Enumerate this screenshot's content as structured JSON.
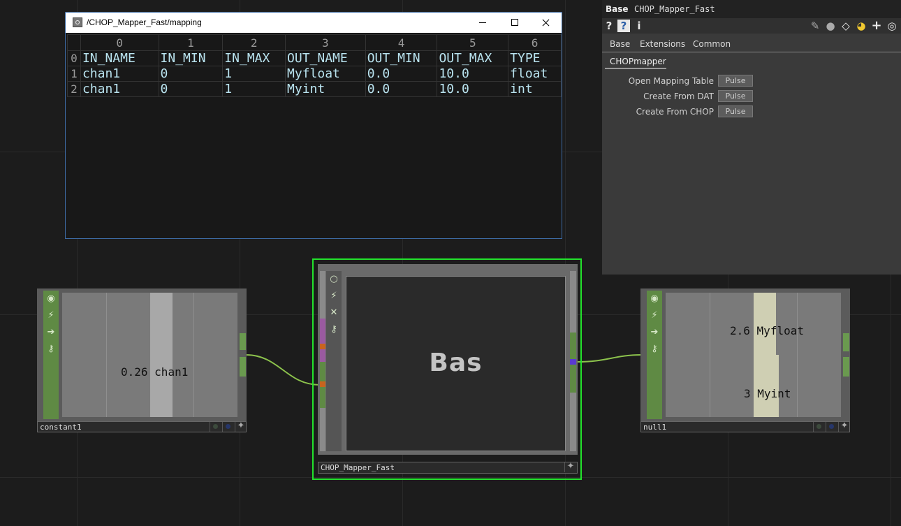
{
  "viewer_window": {
    "title": "/CHOP_Mapper_Fast/mapping",
    "col_headers": [
      "0",
      "1",
      "2",
      "3",
      "4",
      "5",
      "6"
    ],
    "rows": [
      {
        "index": "0",
        "cells": [
          "IN_NAME",
          "IN_MIN",
          "IN_MAX",
          "OUT_NAME",
          "OUT_MIN",
          "OUT_MAX",
          "TYPE"
        ]
      },
      {
        "index": "1",
        "cells": [
          "chan1",
          "0",
          "1",
          "Myfloat",
          "0.0",
          "10.0",
          "float"
        ]
      },
      {
        "index": "2",
        "cells": [
          "chan1",
          "0",
          "1",
          "Myint",
          "0.0",
          "10.0",
          "int"
        ]
      }
    ]
  },
  "param_panel": {
    "op_type": "Base",
    "op_name": "CHOP_Mapper_Fast",
    "icons": [
      "help-icon",
      "python-help-icon",
      "info-icon",
      "pencil-icon",
      "comment-icon",
      "clone-icon",
      "python-icon",
      "plus-icon",
      "target-icon"
    ],
    "tabs": [
      "Base",
      "Extensions",
      "Common"
    ],
    "active_page": "CHOPmapper",
    "params": [
      {
        "label": "Open Mapping Table",
        "button": "Pulse"
      },
      {
        "label": "Create From DAT",
        "button": "Pulse"
      },
      {
        "label": "Create From CHOP",
        "button": "Pulse"
      }
    ]
  },
  "nodes": {
    "constant1": {
      "name": "constant1",
      "value": "0.26",
      "channel": "chan1",
      "value_fraction": 0.26
    },
    "comp": {
      "name": "CHOP_Mapper_Fast",
      "label": "Bas"
    },
    "null1": {
      "name": "null1",
      "channels": [
        {
          "value": "2.6",
          "channel": "Myfloat",
          "value_fraction": 0.26
        },
        {
          "value": "3",
          "channel": "Myint",
          "value_fraction": 0.3
        }
      ]
    }
  },
  "colors": {
    "selected_outline": "#22e22c",
    "node_strip": "#5f8a44",
    "wire": "#8cc24c",
    "table_text": "#b9e3ef"
  }
}
